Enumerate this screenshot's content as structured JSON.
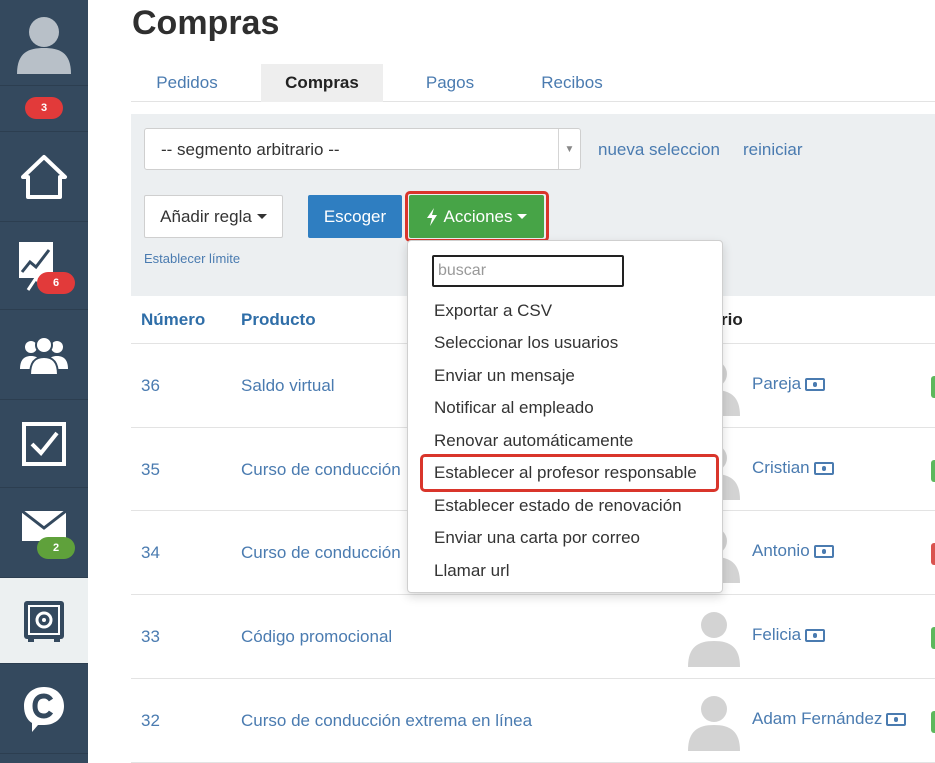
{
  "page": {
    "title": "Compras"
  },
  "sidebar": {
    "badges": {
      "notifications": "3",
      "sales": "6",
      "messages": "2"
    },
    "colors": {
      "background": "#34495e",
      "active": "#ecf0f1"
    }
  },
  "tabs": [
    {
      "label": "Pedidos"
    },
    {
      "label": "Compras"
    },
    {
      "label": "Pagos"
    },
    {
      "label": "Recibos"
    }
  ],
  "filters": {
    "segment_value": "-- segmento arbitrario --",
    "new_selection": "nueva seleccion",
    "reset": "reiniciar",
    "add_rule": "Añadir regla",
    "choose": "Escoger",
    "actions": "Acciones",
    "set_limit": "Establecer límite"
  },
  "actions_menu": {
    "search_placeholder": "buscar",
    "items": [
      "Exportar a CSV",
      "Seleccionar los usuarios",
      "Enviar un mensaje",
      "Notificar al empleado",
      "Renovar automáticamente",
      "Establecer al profesor responsable",
      "Establecer estado de renovación",
      "Enviar una carta por correo",
      "Llamar url"
    ]
  },
  "table": {
    "headers": {
      "number": "Número",
      "product": "Producto",
      "user": "rio"
    },
    "rows": [
      {
        "number": "36",
        "product": "Saldo virtual",
        "user": "Pareja",
        "status_color": "#5cb85c"
      },
      {
        "number": "35",
        "product": "Curso de conducción",
        "user": "Cristian",
        "status_color": "#5cb85c"
      },
      {
        "number": "34",
        "product": "Curso de conducción",
        "user": "Antonio",
        "status_color": "#d9534f"
      },
      {
        "number": "33",
        "product": "Código promocional",
        "user": "Felicia",
        "status_color": "#5cb85c"
      },
      {
        "number": "32",
        "product": "Curso de conducción extrema en línea",
        "user": "Adam Fernández",
        "status_color": "#5cb85c"
      }
    ]
  }
}
